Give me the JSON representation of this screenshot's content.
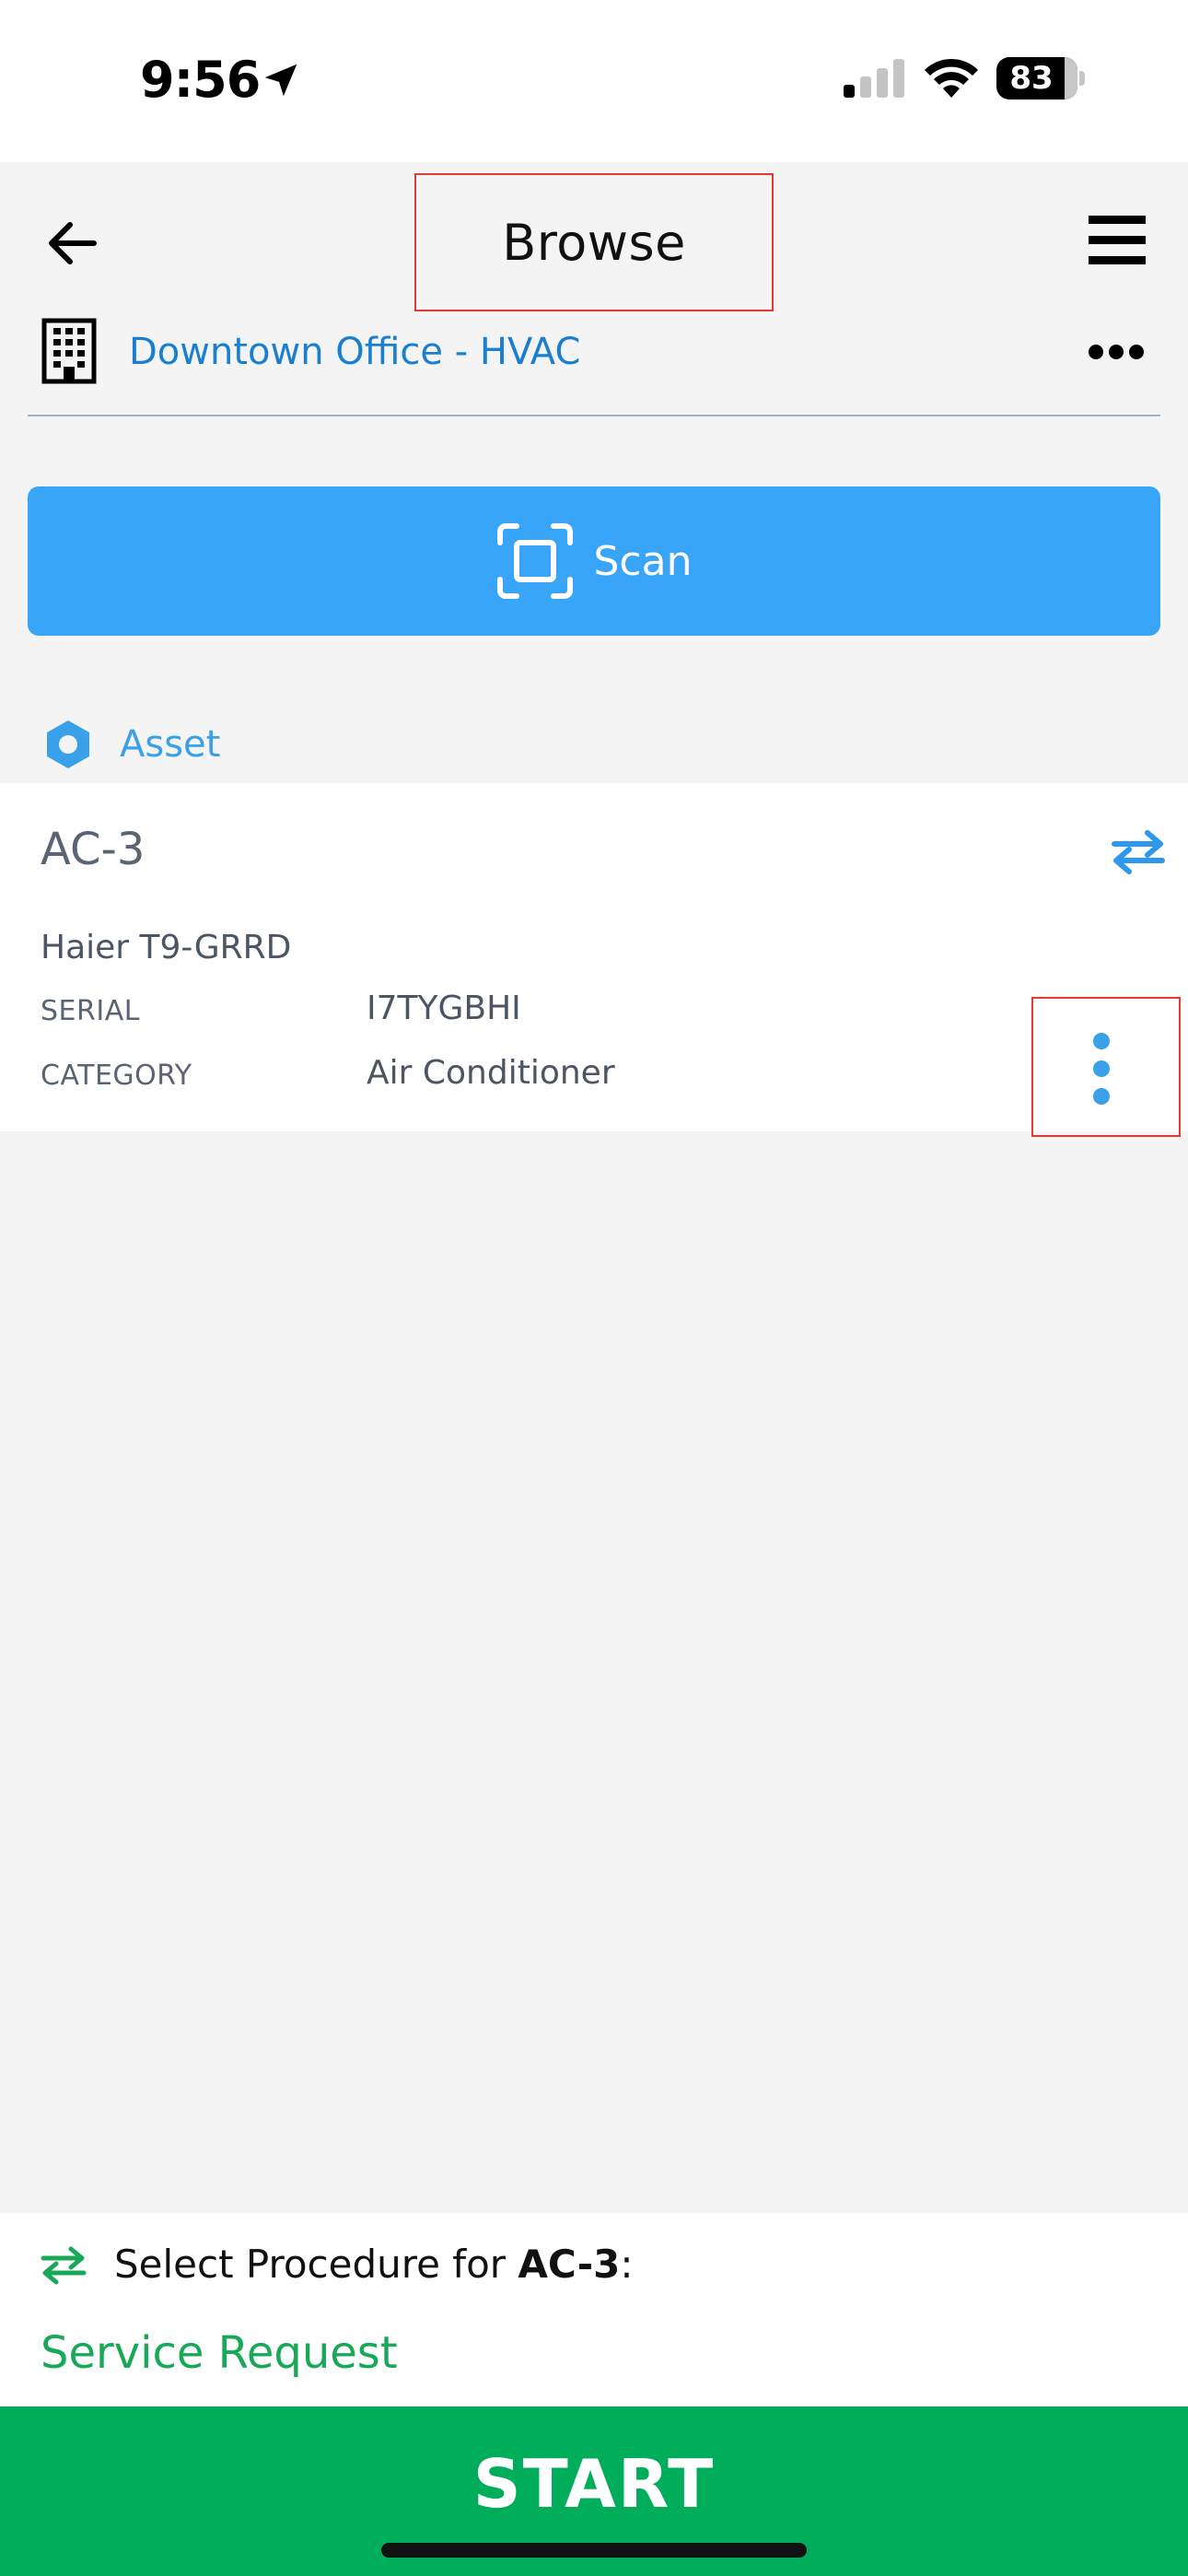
{
  "status_bar": {
    "time": "9:56",
    "battery": "83"
  },
  "header": {
    "title": "Browse",
    "location": "Downtown Office - HVAC"
  },
  "scan": {
    "label": "Scan"
  },
  "asset_section": {
    "label": "Asset"
  },
  "asset": {
    "name": "AC-3",
    "model": "Haier T9-GRRD",
    "serial_label": "SERIAL",
    "serial_value": "I7TYGBHI",
    "category_label": "CATEGORY",
    "category_value": "Air Conditioner"
  },
  "procedure": {
    "prefix": "Select Procedure for ",
    "asset_name": "AC-3",
    "suffix": ":",
    "option": "Service Request"
  },
  "start": {
    "label": "START"
  },
  "colors": {
    "accent_blue": "#38a5f8",
    "link_blue": "#1a7fd0",
    "green": "#00ad5a",
    "highlight_red": "#e53935"
  }
}
